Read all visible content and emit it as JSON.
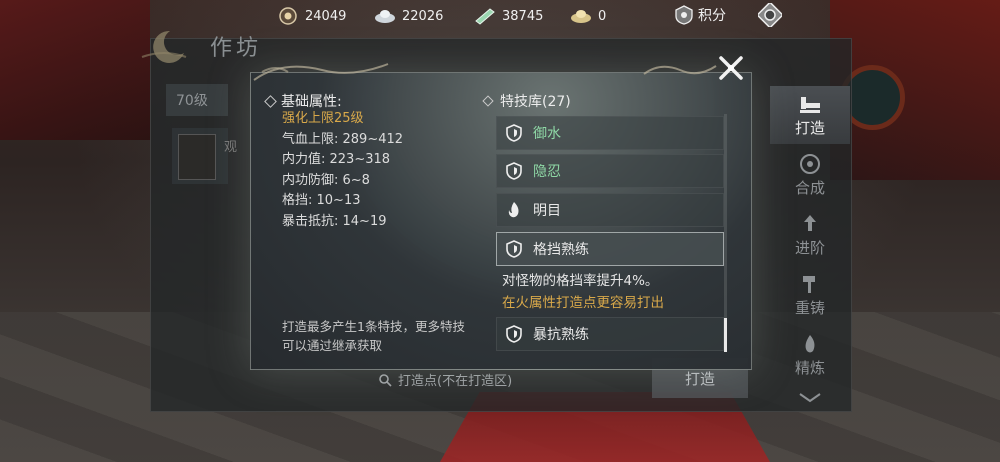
{
  "resources": {
    "r1": {
      "icon": "coin-pouch-icon",
      "value": "24049"
    },
    "r2": {
      "icon": "silver-ingot-icon",
      "value": "22026"
    },
    "r3": {
      "icon": "ticket-icon",
      "value": "38745"
    },
    "r4": {
      "icon": "gold-ingot-icon",
      "value": "0"
    },
    "score": {
      "icon": "score-emblem-icon",
      "label": "积分"
    },
    "shop": {
      "icon": "shop-gear-icon"
    }
  },
  "workshop": {
    "title": "作坊",
    "level_filter": "70级",
    "item_label": "观",
    "forge_point": "打造点(不在打造区)",
    "forge_button": "打造",
    "tabs": [
      {
        "label": "打造",
        "icon": "anvil-icon",
        "active": true
      },
      {
        "label": "合成",
        "icon": "merge-icon",
        "active": false
      },
      {
        "label": "进阶",
        "icon": "advance-icon",
        "active": false
      },
      {
        "label": "重铸",
        "icon": "hammer-icon",
        "active": false
      },
      {
        "label": "精炼",
        "icon": "flame-icon",
        "active": false
      }
    ]
  },
  "modal": {
    "attributes": {
      "title": "基础属性:",
      "strengthen_cap": "强化上限25级",
      "lines": [
        "气血上限: 289~412",
        "内力值: 223~318",
        "内功防御: 6~8",
        "格挡: 10~13",
        "暴击抵抗: 14~19"
      ],
      "note": "打造最多产生1条特技，更多特技可以通过继承获取"
    },
    "skills": {
      "title": "特技库(27)",
      "items": [
        {
          "name": "御水",
          "icon": "shield-icon",
          "color": "#8fd9a6"
        },
        {
          "name": "隐忍",
          "icon": "shield-icon",
          "color": "#8fd9a6"
        },
        {
          "name": "明目",
          "icon": "fire-icon",
          "color": "#e8e8e8"
        },
        {
          "name": "格挡熟练",
          "icon": "shield-icon",
          "color": "#e8e8e8",
          "selected": true
        },
        {
          "name": "暴抗熟练",
          "icon": "shield-icon",
          "color": "#e8e8e8"
        }
      ],
      "selected_desc": "对怪物的格挡率提升4%。",
      "selected_hint": "在火属性打造点更容易打出"
    },
    "close_icon": "close-icon"
  }
}
